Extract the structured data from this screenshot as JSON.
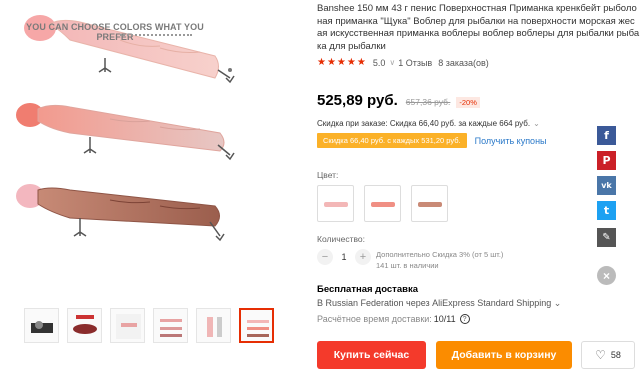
{
  "gallery": {
    "promo_text": "YOU CAN CHOOSE COLORS WHAT YOU PREFER",
    "thumbnail_count": 6,
    "active_thumbnail": 6
  },
  "product": {
    "title_lines": [
      "Banshee 150 мм 43 г пенис Поверхностная Приманка кренкбейт рыболо",
      "ная приманка \"Щука\" Воблер для рыбалки на поверхности морская жес",
      "ая искусственная приманка воблеры воблер воблеры для рыбалки рыба",
      "ка для рыбалки"
    ],
    "stars": "★★★★★",
    "rating": "5.0",
    "reviews": "1 Отзыв",
    "orders": "8 заказа(ов)",
    "price": "525,89 руб.",
    "old_price": "657,36 руб.",
    "discount": "-20%",
    "store_discount": "Скидка при заказе: Скидка 66,40 руб. за каждые 664 руб.",
    "coupon_tag": "Скидка 66,40 руб. с каждых 531,20 руб.",
    "coupon_link": "Получить купоны"
  },
  "options": {
    "color_label": "Цвет:",
    "quantity_label": "Количество:",
    "quantity_value": "1",
    "quantity_info_1": "Дополнительно Скидка 3% (от 5 шт.)",
    "quantity_info_2": "141 шт. в наличии"
  },
  "shipping": {
    "title": "Бесплатная доставка",
    "line": "В Russian Federation через AliExpress Standard Shipping",
    "time_label": "Расчётное время доставки:",
    "time_value": "10/11"
  },
  "actions": {
    "buy_now": "Купить сейчас",
    "add_to_cart": "Добавить в корзину",
    "wish_count": "58"
  },
  "colors": {
    "accent": "#e62e04",
    "buy": "#f43a2b",
    "cart": "#fb8c00",
    "coupon": "#fbb128",
    "link": "#2a79c9"
  }
}
